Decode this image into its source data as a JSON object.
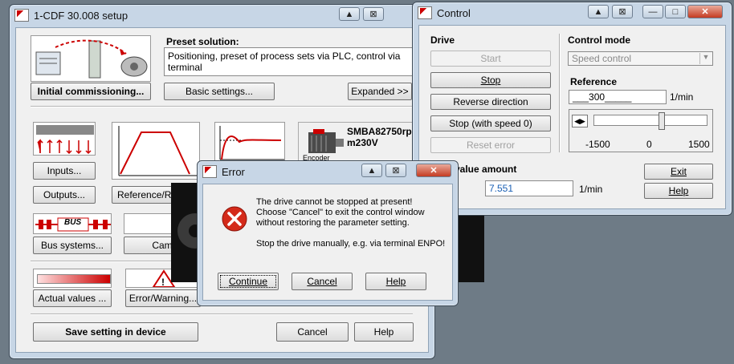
{
  "setup_window": {
    "title": "1-CDF 30.008 setup",
    "preset_label": "Preset solution:",
    "preset_text": "Positioning, preset of process sets via PLC, control via terminal",
    "initial_commissioning": "Initial commissioning...",
    "basic_settings": "Basic settings...",
    "expanded": "Expanded >>",
    "inputs": "Inputs...",
    "outputs": "Outputs...",
    "reference": "Reference/Ra",
    "bus_systems": "Bus systems...",
    "bus_label": "BUS",
    "cam": "Cam",
    "actual_values": "Actual values ...",
    "error_warning": "Error/Warning...",
    "motor_name": "SMBA82750rp m230V",
    "encoder": "Encoder",
    "save_setting": "Save setting in device",
    "cancel": "Cancel",
    "help": "Help"
  },
  "control_window": {
    "title": "Control",
    "drive_label": "Drive",
    "start": "Start",
    "stop": "Stop",
    "reverse_direction": "Reverse direction",
    "stop_speed0": "Stop (with speed 0)",
    "reset_error": "Reset error",
    "control_mode_label": "Control mode",
    "control_mode_value": "Speed control",
    "reference_label": "Reference",
    "reference_value": "___300_____",
    "reference_unit": "1/min",
    "slider_min": "-1500",
    "slider_mid": "0",
    "slider_max": "1500",
    "slider_value": 300,
    "value_amount_label": "value amount",
    "value_amount": "7.551",
    "value_unit": "1/min",
    "exit": "Exit",
    "help": "Help"
  },
  "error_dialog": {
    "title": "Error",
    "line1": "The drive cannot be stopped at present!",
    "line2": "Choose \"Cancel\" to exit the control window",
    "line3": "without restoring the parameter setting.",
    "line4": "Stop the drive manually, e.g. via terminal ENPO!",
    "continue": "Continue",
    "cancel": "Cancel",
    "help": "Help"
  },
  "colors": {
    "accent_red": "#cc1111",
    "value_blue": "#1a5fb4"
  }
}
